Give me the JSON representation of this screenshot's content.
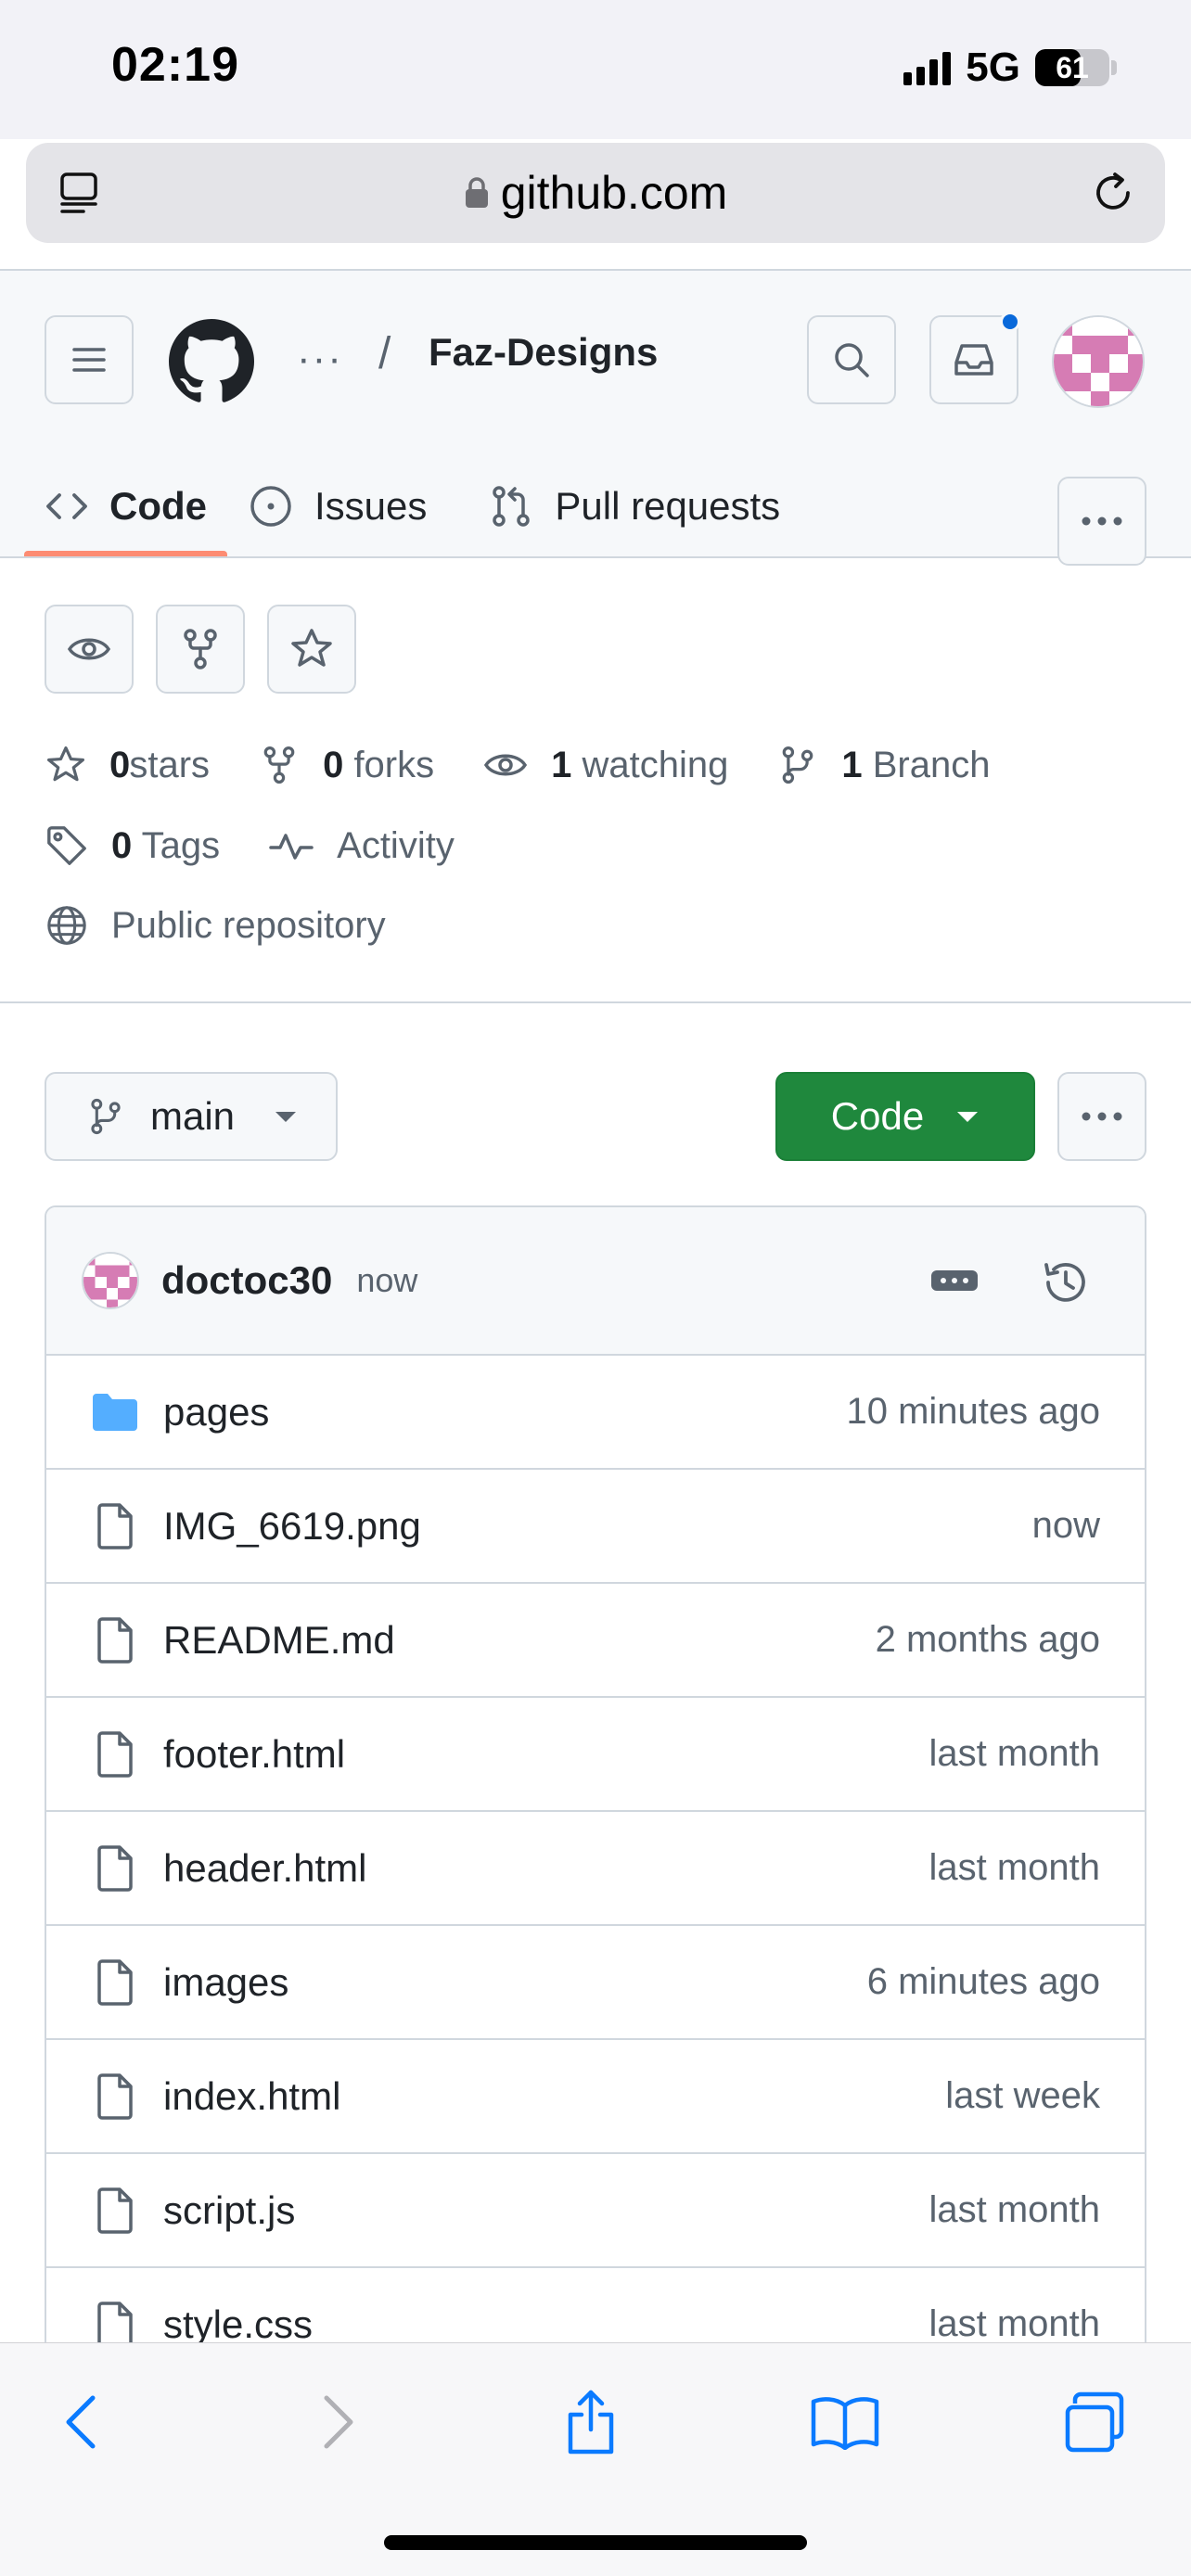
{
  "status_bar": {
    "time": "02:19",
    "network": "5G",
    "battery": "61",
    "battery_level": 0.61
  },
  "browser": {
    "url": "github.com",
    "icons": [
      "reader-icon",
      "lock-icon",
      "reload-icon"
    ]
  },
  "repo_header": {
    "breadcrumb_ellipsis": "···",
    "breadcrumb_separator": "/",
    "repo_name": "Faz-Designs",
    "icons": [
      "hamburger-menu-icon",
      "github-logo-icon",
      "search-icon",
      "inbox-icon",
      "avatar"
    ],
    "notification_dot_color": "#0969da"
  },
  "tabs": [
    {
      "label": "Code",
      "icon": "code-icon",
      "selected": true
    },
    {
      "label": "Issues",
      "icon": "issue-opened-icon",
      "selected": false
    },
    {
      "label": "Pull requests",
      "icon": "git-pull-request-icon",
      "selected": false
    }
  ],
  "repo_actions": [
    "eye-icon",
    "repo-forked-icon",
    "star-icon"
  ],
  "stats": {
    "stars_count": "0",
    "stars_label": "stars",
    "forks_count": "0",
    "forks_label": "forks",
    "watching_count": "1",
    "watching_label": "watching",
    "branch_count": "1",
    "branch_label": "Branch",
    "tags_count": "0",
    "tags_label": "Tags",
    "activity_label": "Activity",
    "visibility_label": "Public repository"
  },
  "branch": {
    "name": "main"
  },
  "code_button": {
    "label": "Code",
    "color": "#1f883d"
  },
  "latest_commit": {
    "author": "doctoc30",
    "time": "now"
  },
  "files": [
    {
      "name": "pages",
      "time": "10 minutes ago",
      "type": "folder"
    },
    {
      "name": "IMG_6619.png",
      "time": "now",
      "type": "file"
    },
    {
      "name": "README.md",
      "time": "2 months ago",
      "type": "file"
    },
    {
      "name": "footer.html",
      "time": "last month",
      "type": "file"
    },
    {
      "name": "header.html",
      "time": "last month",
      "type": "file"
    },
    {
      "name": "images",
      "time": "6 minutes ago",
      "type": "file"
    },
    {
      "name": "index.html",
      "time": "last week",
      "type": "file"
    },
    {
      "name": "script.js",
      "time": "last month",
      "type": "file"
    },
    {
      "name": "style.css",
      "time": "last month",
      "type": "file"
    }
  ],
  "toolbar": {
    "icons": [
      "back-icon",
      "forward-icon",
      "share-icon",
      "bookmarks-icon",
      "tabs-icon"
    ]
  }
}
